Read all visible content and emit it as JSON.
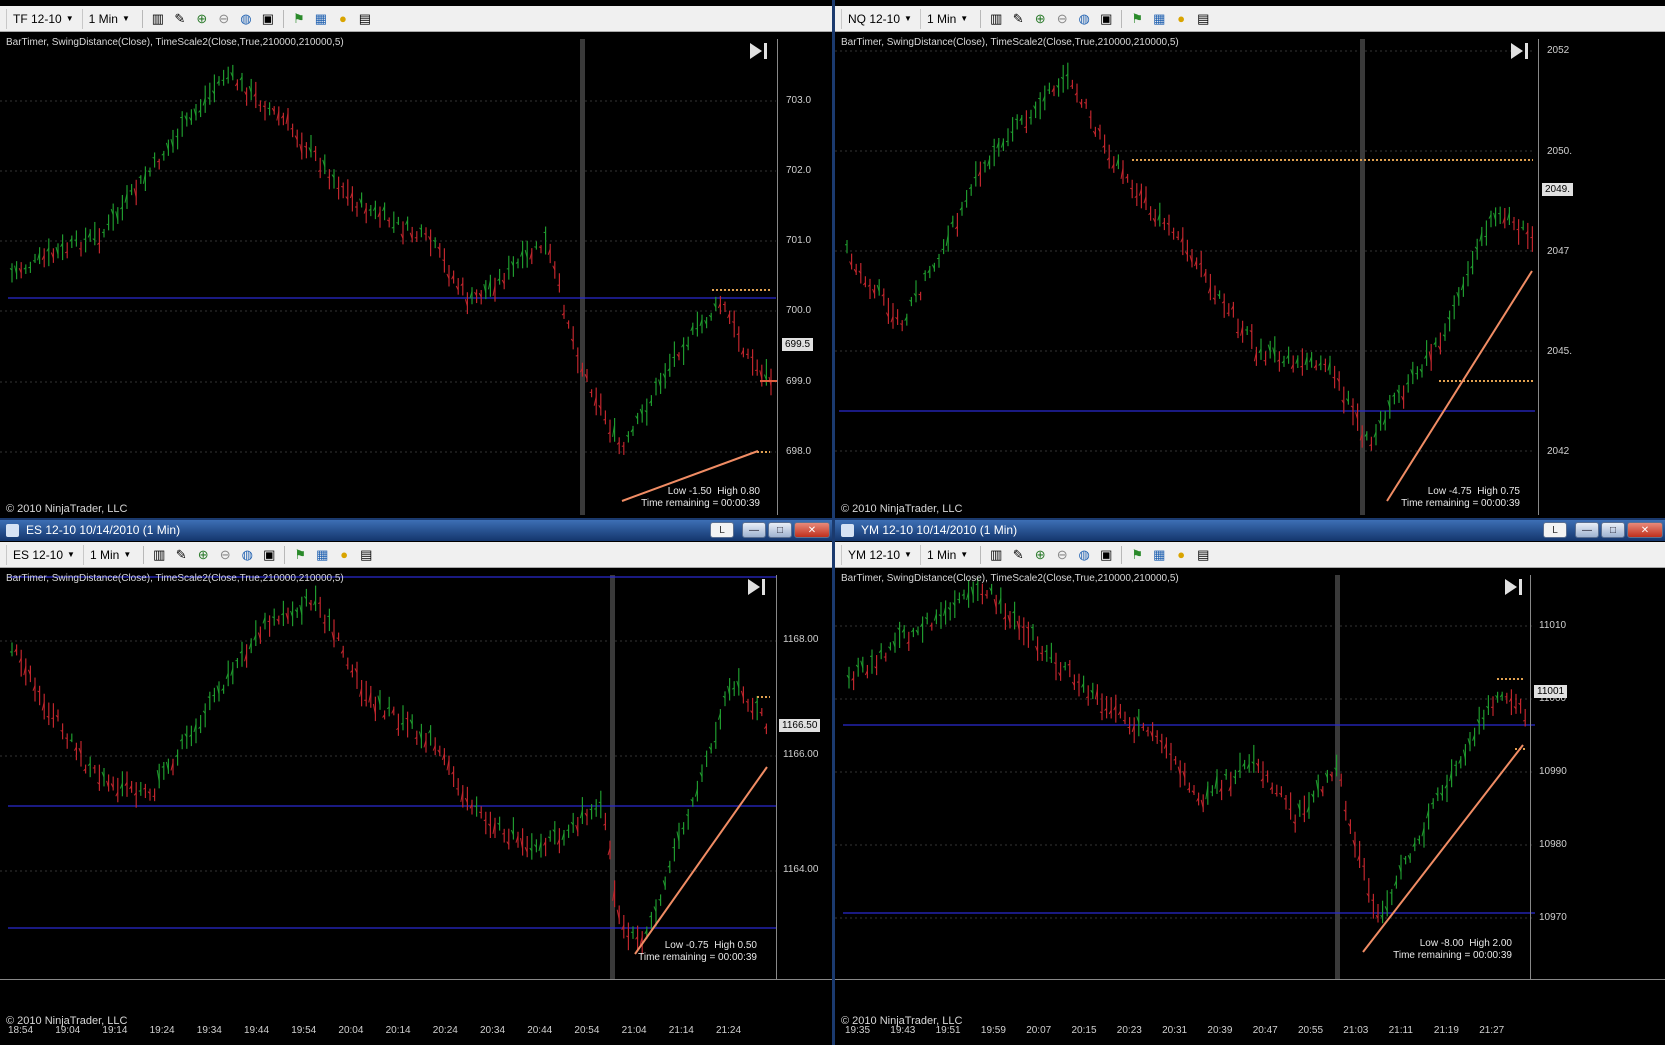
{
  "windows": [
    {
      "id": "tf",
      "toolbar": {
        "instrument": "TF 12-10",
        "interval": "1 Min"
      },
      "indicators": "BarTimer,  SwingDistance(Close),  TimeScale2(Close,True,210000,210000,5)",
      "copyright": "© 2010 NinjaTrader, LLC",
      "swing_low": "Low -1.50",
      "swing_high": "High 0.80",
      "time_remaining": "Time remaining = 00:00:39",
      "current_price": "699.5",
      "price_ticks": [
        "703.0",
        "702.0",
        "701.0",
        "700.0",
        "699.0",
        "698.0"
      ],
      "time_ticks": []
    },
    {
      "id": "nq",
      "toolbar": {
        "instrument": "NQ 12-10",
        "interval": "1 Min"
      },
      "indicators": "BarTimer,  SwingDistance(Close),  TimeScale2(Close,True,210000,210000,5)",
      "copyright": "© 2010 NinjaTrader, LLC",
      "swing_low": "Low -4.75",
      "swing_high": "High 0.75",
      "time_remaining": "Time remaining = 00:00:39",
      "current_price": "2049.",
      "price_ticks": [
        "2052",
        "2050.",
        "2047",
        "2045.",
        "2042"
      ],
      "time_ticks": []
    },
    {
      "id": "es",
      "title": "ES 12-10  10/14/2010 (1 Min)",
      "toolbar": {
        "instrument": "ES 12-10",
        "interval": "1 Min"
      },
      "indicators": "BarTimer,  SwingDistance(Close),  TimeScale2(Close,True,210000,210000,5)",
      "copyright": "© 2010 NinjaTrader, LLC",
      "swing_low": "Low -0.75",
      "swing_high": "High 0.50",
      "time_remaining": "Time remaining = 00:00:39",
      "current_price": "1166.50",
      "price_ticks": [
        "1168.00",
        "1166.00",
        "1164.00"
      ],
      "time_ticks": [
        "18:54",
        "19:04",
        "19:14",
        "19:24",
        "19:34",
        "19:44",
        "19:54",
        "20:04",
        "20:14",
        "20:24",
        "20:34",
        "20:44",
        "20:54",
        "21:04",
        "21:14",
        "21:24"
      ]
    },
    {
      "id": "ym",
      "title": "YM 12-10  10/14/2010 (1 Min)",
      "toolbar": {
        "instrument": "YM 12-10",
        "interval": "1 Min"
      },
      "indicators": "BarTimer,  SwingDistance(Close),  TimeScale2(Close,True,210000,210000,5)",
      "copyright": "© 2010 NinjaTrader, LLC",
      "swing_low": "Low -8.00",
      "swing_high": "High 2.00",
      "time_remaining": "Time remaining = 00:00:39",
      "current_price": "11001",
      "price_ticks": [
        "11010",
        "11000",
        "10990",
        "10980",
        "10970"
      ],
      "time_ticks": [
        "19:35",
        "19:43",
        "19:51",
        "19:59",
        "20:07",
        "20:15",
        "20:23",
        "20:31",
        "20:39",
        "20:47",
        "20:55",
        "21:03",
        "21:11",
        "21:19",
        "21:27"
      ]
    }
  ],
  "window_buttons": {
    "lock": "L",
    "minimize": "—",
    "maximize": "□",
    "close": "✕"
  },
  "colors": {
    "up_bar": "#1f9a2e",
    "down_bar": "#c0262d",
    "swing_line": "#f08c64",
    "level_line": "#2a2ad0",
    "dotted_level": "#e0a050"
  },
  "icons": [
    "chart-style-icon",
    "draw-pencil-icon",
    "zoom-in-icon",
    "zoom-out-icon",
    "globe-icon",
    "properties-icon",
    "strategy-icon",
    "indicator-icon",
    "coin-icon",
    "data-box-icon"
  ]
}
